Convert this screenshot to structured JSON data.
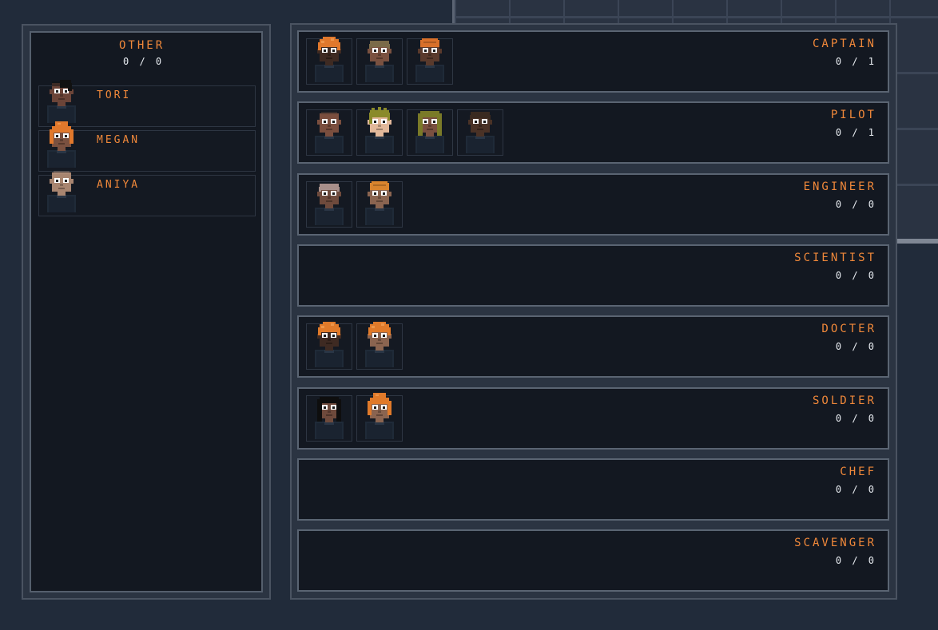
{
  "other_panel": {
    "title": "OTHER",
    "count": "0 / 0",
    "crew": [
      {
        "name": "TORI",
        "skin": "#6b4438",
        "hair": "#111111",
        "hair_style": "side"
      },
      {
        "name": "MEGAN",
        "skin": "#7a5140",
        "hair": "#e0782c",
        "hair_style": "bun"
      },
      {
        "name": "ANIYA",
        "skin": "#a88570",
        "hair": "#b89680",
        "hair_style": "bald"
      }
    ]
  },
  "roles": [
    {
      "title": "CAPTAIN",
      "count": "0 / 1",
      "crew": [
        {
          "skin": "#3e2a22",
          "hair": "#e0782c",
          "hair_style": "curly"
        },
        {
          "skin": "#7a5140",
          "hair": "#7a6a48",
          "hair_style": "short"
        },
        {
          "skin": "#5a3a2c",
          "hair": "#d8702a",
          "hair_style": "flat"
        }
      ]
    },
    {
      "title": "PILOT",
      "count": "0 / 1",
      "crew": [
        {
          "skin": "#7a4e3e",
          "hair": "#6e4a3a",
          "hair_style": "bald"
        },
        {
          "skin": "#e2b89a",
          "hair": "#8a8a2a",
          "hair_style": "spiky"
        },
        {
          "skin": "#7a5040",
          "hair": "#7a7a28",
          "hair_style": "long"
        },
        {
          "skin": "#4a3226",
          "hair": "#3a2a20",
          "hair_style": "short"
        }
      ]
    },
    {
      "title": "ENGINEER",
      "count": "0 / 0",
      "crew": [
        {
          "skin": "#6e4a3c",
          "hair": "#a88f8a",
          "hair_style": "short"
        },
        {
          "skin": "#8a6450",
          "hair": "#d8842e",
          "hair_style": "flat"
        }
      ]
    },
    {
      "title": "SCIENTIST",
      "count": "0 / 0",
      "crew": []
    },
    {
      "title": "DOCTER",
      "count": "0 / 0",
      "crew": [
        {
          "skin": "#3e2a22",
          "hair": "#e07a2a",
          "hair_style": "curly"
        },
        {
          "skin": "#8a6450",
          "hair": "#e07a2a",
          "hair_style": "curly"
        }
      ]
    },
    {
      "title": "SOLDIER",
      "count": "0 / 0",
      "crew": [
        {
          "skin": "#6e4a3c",
          "hair": "#0e0e0e",
          "hair_style": "long"
        },
        {
          "skin": "#8a6450",
          "hair": "#e07a2a",
          "hair_style": "bun"
        }
      ]
    },
    {
      "title": "CHEF",
      "count": "0 / 0",
      "crew": []
    },
    {
      "title": "SCAVENGER",
      "count": "0 / 0",
      "crew": []
    }
  ],
  "colors": {
    "accent": "#f0883a",
    "count_text": "#e9edf2",
    "panel_bg": "#131821",
    "page_bg": "#212b3a",
    "uniform": "#1f2a38"
  }
}
